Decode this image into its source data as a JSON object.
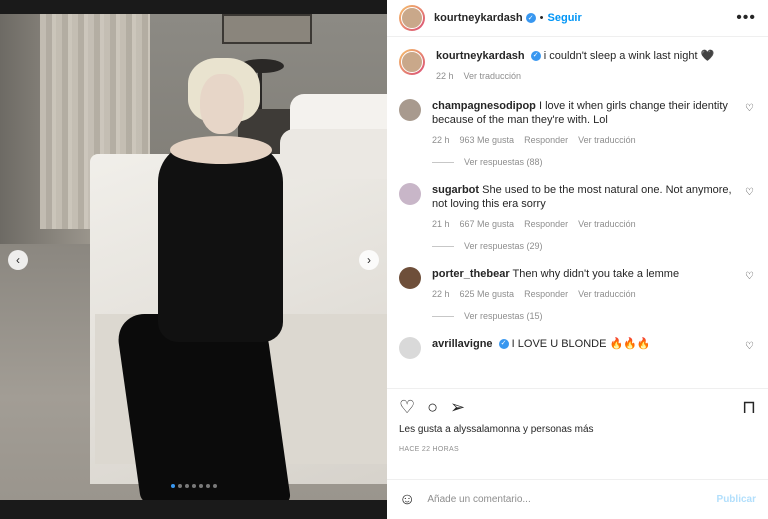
{
  "post": {
    "username": "kourtneykardash",
    "follow_label": "Seguir",
    "more_label": "•••",
    "caption_text": "i couldn't sleep a wink last night 🖤",
    "caption_time": "22 h",
    "caption_translate": "Ver traducción"
  },
  "media": {
    "prev_icon": "‹",
    "next_icon": "›",
    "slides": 7,
    "active_slide": 1
  },
  "comments": [
    {
      "user": "champagnesodipop",
      "text": "I love it when girls change their identity because of the man they're with. Lol",
      "time": "22 h",
      "likes": "963 Me gusta",
      "reply": "Responder",
      "translate": "Ver traducción",
      "replies": "Ver respuestas (88)",
      "avatar_color": "#a89a8e"
    },
    {
      "user": "sugarbot",
      "text": "She used to be the most natural one. Not anymore, not loving this era sorry",
      "time": "21 h",
      "likes": "667 Me gusta",
      "reply": "Responder",
      "translate": "Ver traducción",
      "replies": "Ver respuestas (29)",
      "avatar_color": "#c8b6c8"
    },
    {
      "user": "porter_thebear",
      "text": "Then why didn't you take a lemme",
      "time": "22 h",
      "likes": "625 Me gusta",
      "reply": "Responder",
      "translate": "Ver traducción",
      "replies": "Ver respuestas (15)",
      "avatar_color": "#6e4f3a"
    },
    {
      "user": "avrillavigne",
      "text": "I LOVE U BLONDE 🔥🔥🔥",
      "avatar_color": "#d9d9d9"
    }
  ],
  "actions": {
    "like_icon": "♡",
    "comment_icon": "○",
    "share_icon": "➢",
    "save_icon": "⊓"
  },
  "likes_text": "Les gusta a alyssalamonna y personas más",
  "time_text": "HACE 22 HORAS",
  "add_comment": {
    "emoji_icon": "☺",
    "placeholder": "Añade un comentario...",
    "publish_label": "Publicar"
  },
  "colors": {
    "accent": "#0095f6",
    "verified": "#3897f0",
    "muted": "#8e8e8e",
    "publish_disabled": "#b2dffc"
  }
}
